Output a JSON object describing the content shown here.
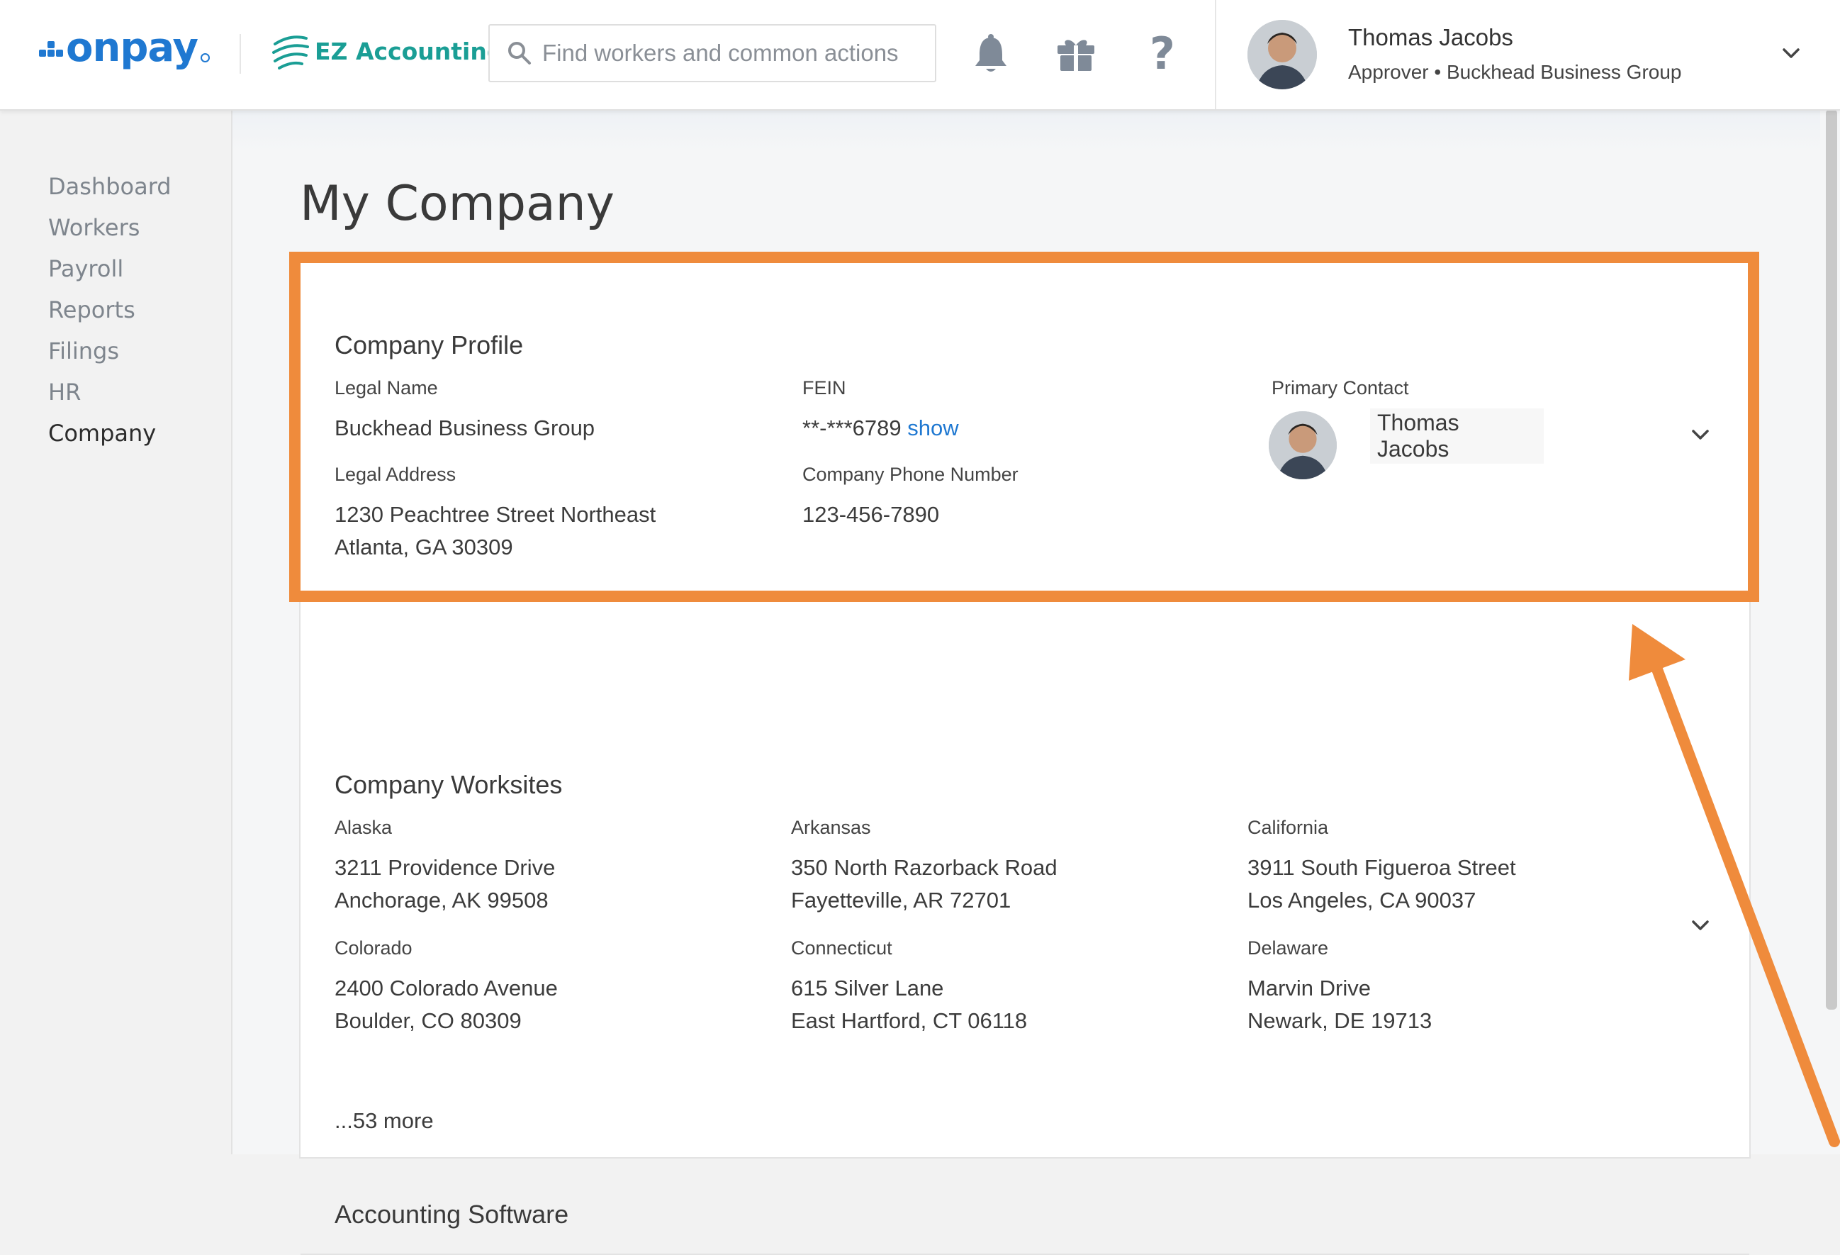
{
  "header": {
    "logo_text": "onpay",
    "integration_name": "EZ Accounting",
    "search_placeholder": "Find workers and common actions",
    "icons": {
      "notifications": "bell-icon",
      "gifts": "gift-icon",
      "help": "help-icon"
    },
    "help_glyph": "?",
    "user": {
      "name": "Thomas Jacobs",
      "role_line": "Approver • Buckhead Business Group"
    }
  },
  "sidebar": {
    "items": [
      {
        "label": "Dashboard"
      },
      {
        "label": "Workers"
      },
      {
        "label": "Payroll"
      },
      {
        "label": "Reports"
      },
      {
        "label": "Filings"
      },
      {
        "label": "HR"
      },
      {
        "label": "Company",
        "active": true
      }
    ]
  },
  "page": {
    "title": "My Company"
  },
  "company_profile": {
    "title": "Company Profile",
    "legal_name": {
      "label": "Legal Name",
      "value": "Buckhead Business Group"
    },
    "fein": {
      "label": "FEIN",
      "value": "**-***6789",
      "link": "show"
    },
    "primary_contact": {
      "label": "Primary Contact",
      "name": "Thomas Jacobs"
    },
    "legal_address": {
      "label": "Legal Address",
      "line1": "1230 Peachtree Street Northeast",
      "line2": "Atlanta, GA 30309"
    },
    "phone": {
      "label": "Company Phone Number",
      "value": "123-456-7890"
    }
  },
  "company_worksites": {
    "title": "Company Worksites",
    "sites": [
      {
        "state": "Alaska",
        "line1": "3211 Providence Drive",
        "line2": "Anchorage, AK 99508"
      },
      {
        "state": "Arkansas",
        "line1": "350 North Razorback Road",
        "line2": "Fayetteville, AR 72701"
      },
      {
        "state": "California",
        "line1": "3911 South Figueroa Street",
        "line2": "Los Angeles, CA 90037"
      },
      {
        "state": "Colorado",
        "line1": "2400 Colorado Avenue",
        "line2": "Boulder, CO 80309"
      },
      {
        "state": "Connecticut",
        "line1": "615 Silver Lane",
        "line2": "East Hartford, CT 06118"
      },
      {
        "state": "Delaware",
        "line1": "Marvin Drive",
        "line2": "Newark, DE 19713"
      }
    ],
    "more_link": "...53 more"
  },
  "accounting_software": {
    "title": "Accounting Software"
  },
  "colors": {
    "brand": "#1f78d1",
    "ez_accent": "#1a9e95",
    "highlight": "#ef8b3c"
  }
}
